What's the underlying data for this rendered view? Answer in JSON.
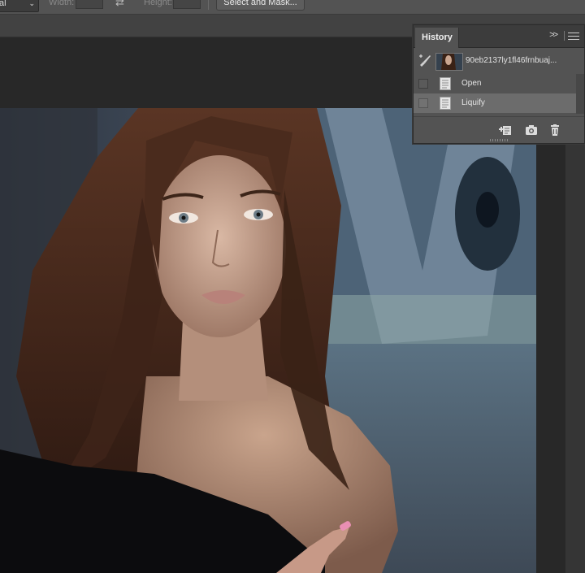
{
  "options_bar": {
    "style_value": "al",
    "width_label": "Width:",
    "height_label": "Height:",
    "swap_icon": "swap-arrow-icon",
    "select_and_mask_label": "Select and Mask..."
  },
  "history_panel": {
    "tab_label": "History",
    "collapse_glyph": ">>",
    "snapshot": {
      "name": "90eb2137ly1fl46frnbuaj..."
    },
    "states": [
      {
        "label": "Open",
        "selected": false
      },
      {
        "label": "Liquify",
        "selected": true
      }
    ],
    "footer_icons": [
      "new-document-from-state-icon",
      "camera-icon",
      "trash-icon"
    ]
  },
  "colors": {
    "panel_bg": "#535353",
    "selected_row": "#6c6c6c",
    "workspace": "#282828"
  }
}
